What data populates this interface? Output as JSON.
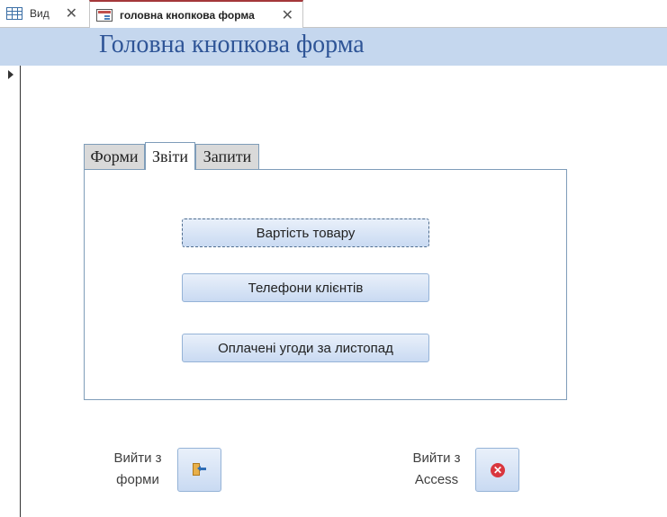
{
  "doc_tabs": [
    {
      "label": "Вид",
      "icon": "table-icon",
      "close": "✕"
    },
    {
      "label": "головна кнопкова форма",
      "icon": "form-icon",
      "close": "✕"
    }
  ],
  "header": {
    "title": "Головна кнопкова форма"
  },
  "tabs": [
    {
      "label": "Форми"
    },
    {
      "label": "Звіти"
    },
    {
      "label": "Запити"
    }
  ],
  "active_tab": "Звіти",
  "report_buttons": [
    {
      "label": "Вартість товару"
    },
    {
      "label": "Телефони клієнтів"
    },
    {
      "label": "Оплачені угоди за листопад"
    }
  ],
  "footer": {
    "exit_form_label_line1": "Вийти з",
    "exit_form_label_line2": "форми",
    "exit_access_label_line1": "Вийти з",
    "exit_access_label_line2": "Access",
    "exit_access_icon_glyph": "✕"
  },
  "colors": {
    "header_band": "#c5d7ee",
    "title": "#2f5597",
    "active_doc_tab_accent": "#a4373a"
  }
}
